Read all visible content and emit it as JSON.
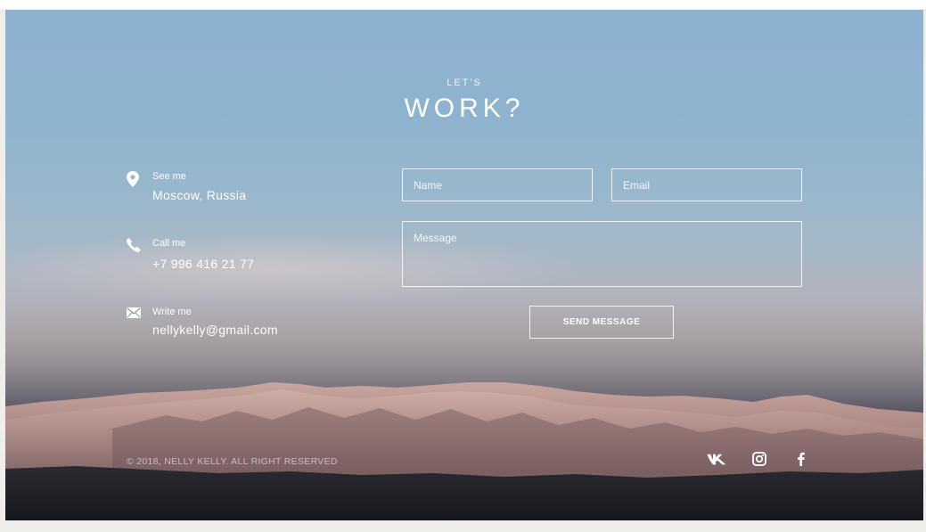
{
  "header": {
    "kicker": "LET'S",
    "title": "WORK?"
  },
  "contact": [
    {
      "icon": "location-pin-icon",
      "label": "See me",
      "value": "Moscow, Russia"
    },
    {
      "icon": "phone-icon",
      "label": "Call me",
      "value": "+7 996 416 21 77"
    },
    {
      "icon": "envelope-icon",
      "label": "Write me",
      "value": "nellykelly@gmail.com"
    }
  ],
  "form": {
    "name_placeholder": "Name",
    "email_placeholder": "Email",
    "message_placeholder": "Message",
    "send_label": "SEND MESSAGE"
  },
  "footer": {
    "copyright": "© 2018, NELLY KELLY. ALL RIGHT RESERVED",
    "social": [
      "vk-icon",
      "instagram-icon",
      "facebook-icon"
    ]
  },
  "colors": {
    "sky_top": "#8db2cf",
    "text": "#ffffff",
    "page_bg": "#efeeea"
  }
}
